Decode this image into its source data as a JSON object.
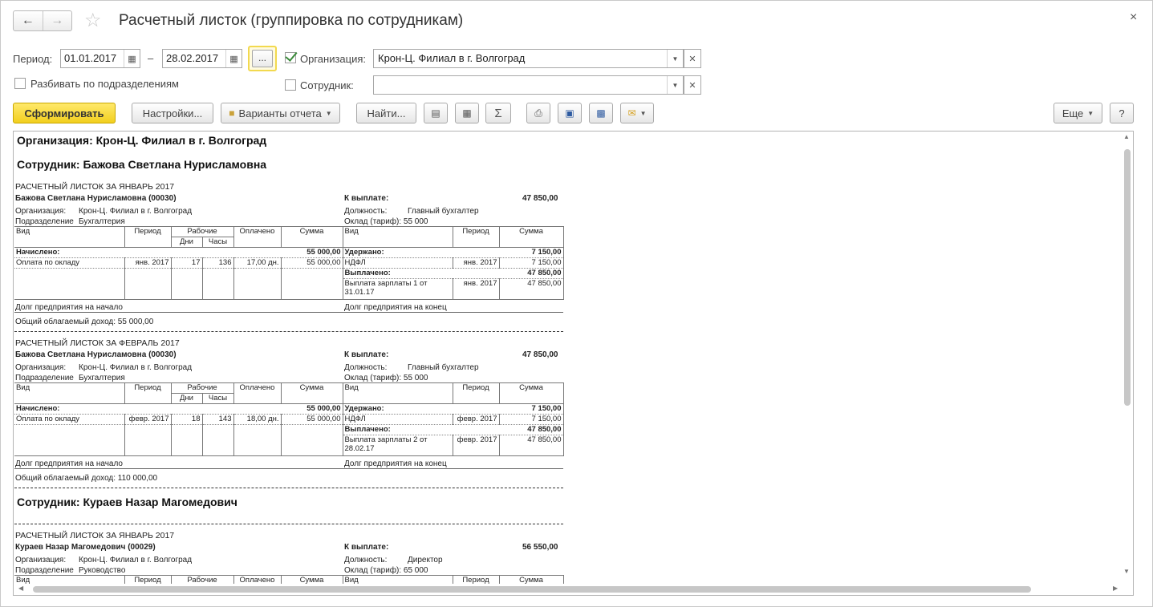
{
  "window": {
    "title": "Расчетный листок (группировка по сотрудникам)"
  },
  "icons": {
    "back": "arrow-left-icon",
    "forward": "arrow-right-icon",
    "favorite": "star-icon",
    "close": "close-icon"
  },
  "filters": {
    "period_label": "Период:",
    "date_from": "01.01.2017",
    "dash": "–",
    "date_to": "28.02.2017",
    "select_period": "...",
    "organization_label": "Организация:",
    "organization_value": "Крон-Ц. Филиал в г. Волгоград",
    "split_by_department_label": "Разбивать по подразделениям",
    "employee_label": "Сотрудник:",
    "employee_value": ""
  },
  "toolbar": {
    "generate": "Сформировать",
    "settings": "Настройки...",
    "variants": "Варианты отчета",
    "find": "Найти...",
    "more": "Еще",
    "help": "?"
  },
  "report": {
    "org_header": "Организация: Крон-Ц. Филиал в г. Волгоград",
    "col": {
      "vid": "Вид",
      "period": "Период",
      "rabochie": "Рабочие",
      "dni": "Дни",
      "chasy": "Часы",
      "oplacheno": "Оплачено",
      "summa": "Сумма"
    },
    "labels": {
      "k_vyplate": "К выплате:",
      "org": "Организация:",
      "dolzhnost": "Должность:",
      "podrazd": "Подразделение",
      "nachisleno": "Начислено:",
      "uderzhano": "Удержано:",
      "vyplacheno": "Выплачено:",
      "dolg_start": "Долг предприятия на начало",
      "dolg_end": "Долг предприятия на конец"
    },
    "employees": [
      {
        "header": "Сотрудник: Бажова Светлана Нурисламовна",
        "sheets": [
          {
            "title": "РАСЧЕТНЫЙ ЛИСТОК ЗА ЯНВАРЬ 2017",
            "name": "Бажова Светлана Нурисламовна (00030)",
            "to_pay": "47 850,00",
            "org": "Крон-Ц. Филиал в г. Волгоград",
            "position": "Главный бухгалтер",
            "dept": "Бухгалтерия",
            "salary": "Оклад (тариф): 55 000",
            "accrued_total": "55 000,00",
            "withheld_total": "7 150,00",
            "paid_total": "47 850,00",
            "accrual": {
              "name": "Оплата по окладу",
              "period": "янв. 2017",
              "days": "17",
              "hours": "136",
              "paid": "17,00 дн.",
              "sum": "55 000,00"
            },
            "withholding": {
              "name": "НДФЛ",
              "period": "янв. 2017",
              "sum": "7 150,00"
            },
            "payout": {
              "name1": "Выплата зарплаты 1 от",
              "name2": "31.01.17",
              "period": "янв. 2017",
              "sum": "47 850,00"
            },
            "taxable": "Общий облагаемый доход: 55 000,00"
          },
          {
            "title": "РАСЧЕТНЫЙ ЛИСТОК ЗА ФЕВРАЛЬ 2017",
            "name": "Бажова Светлана Нурисламовна (00030)",
            "to_pay": "47 850,00",
            "org": "Крон-Ц. Филиал в г. Волгоград",
            "position": "Главный бухгалтер",
            "dept": "Бухгалтерия",
            "salary": "Оклад (тариф): 55 000",
            "accrued_total": "55 000,00",
            "withheld_total": "7 150,00",
            "paid_total": "47 850,00",
            "accrual": {
              "name": "Оплата по окладу",
              "period": "февр. 2017",
              "days": "18",
              "hours": "143",
              "paid": "18,00 дн.",
              "sum": "55 000,00"
            },
            "withholding": {
              "name": "НДФЛ",
              "period": "февр. 2017",
              "sum": "7 150,00"
            },
            "payout": {
              "name1": "Выплата зарплаты 2 от",
              "name2": "28.02.17",
              "period": "февр. 2017",
              "sum": "47 850,00"
            },
            "taxable": "Общий облагаемый доход: 110 000,00"
          }
        ]
      },
      {
        "header": "Сотрудник: Кураев Назар Магомедович",
        "sheet": {
          "title": "РАСЧЕТНЫЙ ЛИСТОК ЗА ЯНВАРЬ 2017",
          "name": "Кураев Назар Магомедович (00029)",
          "to_pay": "56 550,00",
          "org": "Крон-Ц. Филиал в г. Волгоград",
          "position": "Директор",
          "dept": "Руководство",
          "salary": "Оклад (тариф): 65 000"
        }
      }
    ]
  }
}
